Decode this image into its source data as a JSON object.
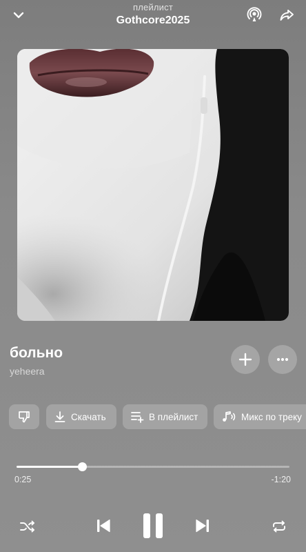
{
  "header": {
    "subtitle": "плейлист",
    "title": "Gothcore2025",
    "collapse_icon": "chevron-down-icon",
    "cast_icon": "airplay-broadcast-icon",
    "share_icon": "share-arrow-icon"
  },
  "cover": {
    "image": "album-cover-photo"
  },
  "track": {
    "title": "больно",
    "artist": "yeheera",
    "add_icon": "plus-icon",
    "more_icon": "more-dots-icon"
  },
  "actions": {
    "dislike_icon": "thumbs-down-icon",
    "download_label": "Скачать",
    "playlist_label": "В плейлист",
    "mix_label": "Микс по треку"
  },
  "progress": {
    "elapsed": "0:25",
    "remaining": "-1:20",
    "fraction": 0.24
  },
  "controls": {
    "shuffle_icon": "shuffle-icon",
    "prev_icon": "previous-track-icon",
    "play_icon": "pause-icon",
    "next_icon": "next-track-icon",
    "repeat_icon": "repeat-icon"
  }
}
